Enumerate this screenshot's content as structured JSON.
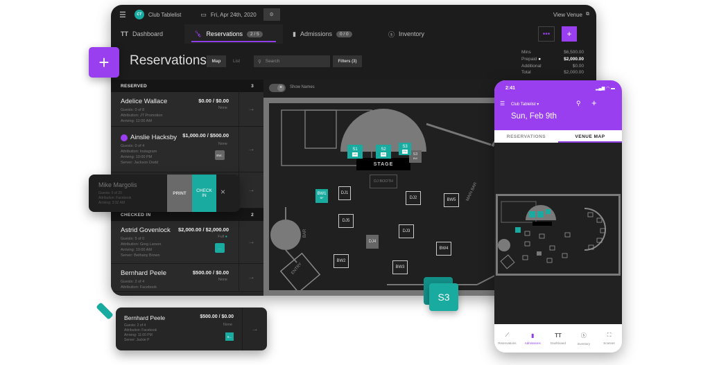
{
  "app": {
    "name": "Club Tablelist",
    "logo_initials": "CT",
    "date": "Fri, Apr 24th, 2020",
    "view_venue": "View Venue"
  },
  "tabs": [
    {
      "label": "Dashboard",
      "icon": "table-icon"
    },
    {
      "label": "Reservations",
      "icon": "bottle-icon",
      "count": "2 / 5",
      "active": true
    },
    {
      "label": "Admissions",
      "icon": "ticket-icon",
      "count": "0 / 0"
    },
    {
      "label": "Inventory",
      "icon": "dollar-circle-icon"
    }
  ],
  "header": {
    "title": "Reservations",
    "view_map": "Map",
    "view_list": "List",
    "search_placeholder": "Search",
    "filters_label": "Filters (3)",
    "summary": [
      {
        "label": "Mins",
        "value": "$6,500.00"
      },
      {
        "label": "Prepaid",
        "value": "$2,000.00",
        "bold": true
      },
      {
        "label": "Additional",
        "value": "$0.00"
      },
      {
        "label": "Total",
        "value": "$2,000.00"
      }
    ]
  },
  "map_controls": {
    "show_names": "Show Names"
  },
  "sections": {
    "reserved": {
      "label": "RESERVED",
      "count": "3"
    },
    "checked_in": {
      "label": "CHECKED IN",
      "count": "2"
    }
  },
  "reservations": [
    {
      "name": "Adelice Wallace",
      "amount": "$0.00 / $0.00",
      "status": "None",
      "guests": "Guests: 0 of 8",
      "attribution": "Attribution: JT Promotion",
      "arriving": "Arriving: 12:00 AM"
    },
    {
      "name": "Ainslie Hacksby",
      "amount": "$1,000.00 / $500.00",
      "status": "None",
      "guests": "Guests: 0 of 4",
      "attribution": "Attribution: Instagram",
      "arriving": "Arriving: 10:00 PM",
      "server": "Server: Jackson Dodd",
      "tag": "BW.."
    }
  ],
  "swipe_card": {
    "name": "Mike Margolis",
    "guests": "Guests: 0 of 20",
    "attribution": "Attribution: Facebook",
    "arriving": "Arriving: 3:32 AM",
    "print": "PRINT",
    "check_in": "CHECK IN"
  },
  "checked_in": [
    {
      "name": "Astrid Govenlock",
      "amount": "$2,000.00 / $2,000.00",
      "status": "Full",
      "guests": "Guests: 5 of 0",
      "attribution": "Attribution: Greg Larson",
      "arriving": "Arriving: 10:00 AM",
      "server": "Server: Bethany Brown",
      "tag": "..."
    },
    {
      "name": "Bernhard Peele",
      "amount": "$500.00 / $0.00",
      "status": "None",
      "guests": "Guests: 2 of 4",
      "attribution": "Attribution: Facebook"
    }
  ],
  "drag_card": {
    "name": "Bernhard Peele",
    "amount": "$500.00 / $0.00",
    "status": "None",
    "guests": "Guests: 2 of 4",
    "attribution": "Attribution: Facebook",
    "arriving": "Arriving: 11:00 PM",
    "server": "Server: Jackie P",
    "tag": "S..."
  },
  "floor": {
    "stage": "STAGE",
    "dj_booth": "DJ BOOTH",
    "main_bar": "MAIN BAR",
    "bar": "BAR",
    "entry": "ENTRY",
    "drag_table": "S3",
    "tables": [
      {
        "id": "S1",
        "sub": "AB",
        "state": "reserved"
      },
      {
        "id": "S2",
        "sub": "AB",
        "state": "reserved"
      },
      {
        "id": "S3",
        "sub": "PB",
        "state": "reserved"
      },
      {
        "id": "S3",
        "sub": "BW",
        "state": "ghost"
      },
      {
        "id": "BW1",
        "sub": "BF",
        "state": "reserved"
      },
      {
        "id": "DJ1",
        "state": "open"
      },
      {
        "id": "DJ2",
        "state": "open"
      },
      {
        "id": "BW5",
        "state": "open"
      },
      {
        "id": "DJ5",
        "state": "open"
      },
      {
        "id": "DJ3",
        "state": "open"
      },
      {
        "id": "DJ4",
        "state": "blocked"
      },
      {
        "id": "BW4",
        "state": "open"
      },
      {
        "id": "BW2",
        "state": "open"
      },
      {
        "id": "BW3",
        "state": "open"
      }
    ]
  },
  "phone": {
    "time": "2:41",
    "venue": "Club Tablelist",
    "date": "Sun, Feb 9th",
    "tabs": [
      "RESERVATIONS",
      "VENUE MAP"
    ],
    "nav": [
      "Reservations",
      "Admissions",
      "Dashboard",
      "Inventory",
      "Scanner"
    ]
  },
  "colors": {
    "accent": "#9a3ff0",
    "teal": "#19aaa0",
    "bg": "#1c1c1c"
  }
}
